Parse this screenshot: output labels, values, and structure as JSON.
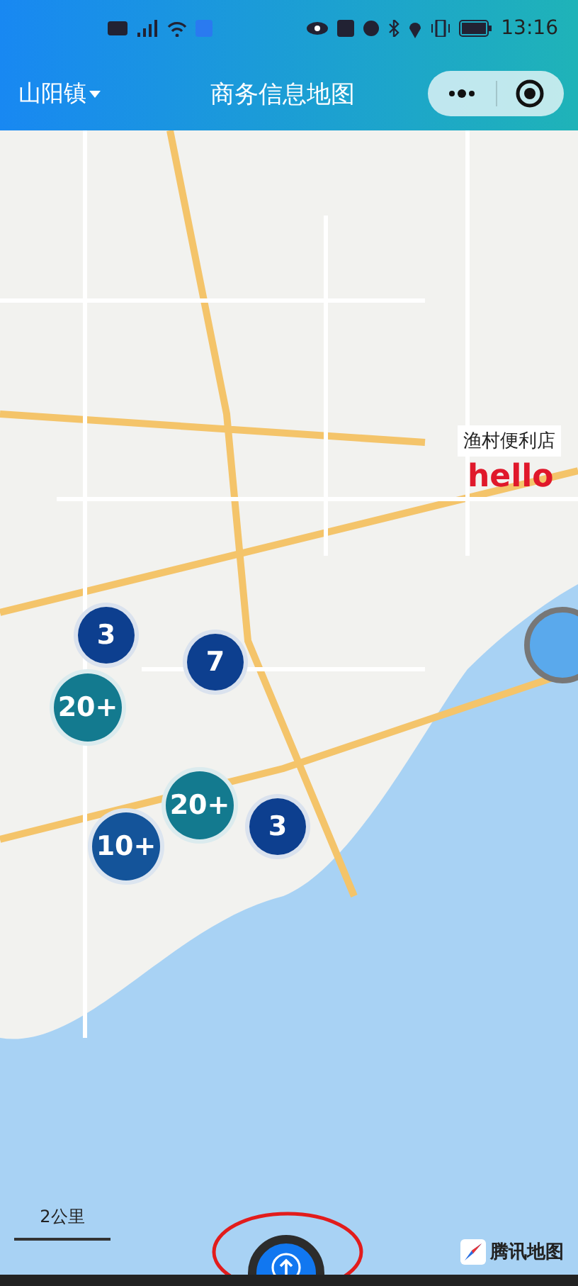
{
  "status_bar": {
    "time": "13:16"
  },
  "nav_bar": {
    "location": "山阳镇",
    "title": "商务信息地图"
  },
  "map": {
    "clusters": [
      {
        "count": "3",
        "color": "#0d3f8f"
      },
      {
        "count": "7",
        "color": "#0d3f8f"
      },
      {
        "count": "20+",
        "color": "#137a8f"
      },
      {
        "count": "20+",
        "color": "#137a8f"
      },
      {
        "count": "10+",
        "color": "#14549a"
      },
      {
        "count": "3",
        "color": "#0d3f8f"
      }
    ],
    "shop_marker": {
      "label": "渔村便利店",
      "logo": "hello"
    },
    "scale": "2公里",
    "attribution": "腾讯地图"
  }
}
